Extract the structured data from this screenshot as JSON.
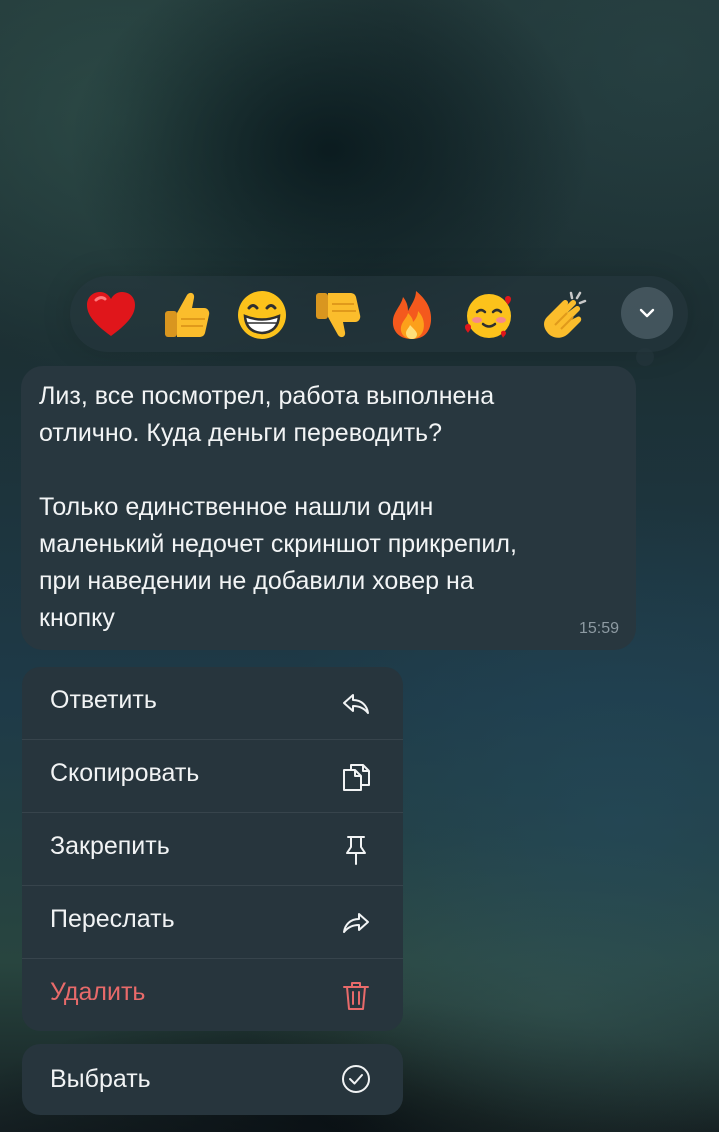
{
  "reactions": [
    {
      "name": "heart",
      "emoji": "❤️"
    },
    {
      "name": "thumbs-up",
      "emoji": "👍"
    },
    {
      "name": "grinning-face",
      "emoji": "😁"
    },
    {
      "name": "thumbs-down",
      "emoji": "👎"
    },
    {
      "name": "fire",
      "emoji": "🔥"
    },
    {
      "name": "smiling-face-with-hearts",
      "emoji": "🥰"
    },
    {
      "name": "clapping-hands",
      "emoji": "👏"
    }
  ],
  "message": {
    "text": "Лиз, все посмотрел, работа выполнена\nотлично. Куда деньги переводить?\n\nТолько единственное нашли один\nмаленький недочет скриншот прикрепил,\nпри наведении не добавили ховер на\nкнопку",
    "time": "15:59"
  },
  "menu": {
    "items": [
      {
        "label": "Ответить",
        "icon": "reply-icon"
      },
      {
        "label": "Скопировать",
        "icon": "copy-icon"
      },
      {
        "label": "Закрепить",
        "icon": "pin-icon"
      },
      {
        "label": "Переслать",
        "icon": "forward-icon"
      },
      {
        "label": "Удалить",
        "icon": "trash-icon"
      }
    ],
    "select": {
      "label": "Выбрать",
      "icon": "check-circle-icon"
    }
  },
  "colors": {
    "danger": "#e86a6a",
    "bubble": "#28373f",
    "menu": "#27353d",
    "text": "#f1f3f4",
    "time": "#8d9aa2"
  }
}
